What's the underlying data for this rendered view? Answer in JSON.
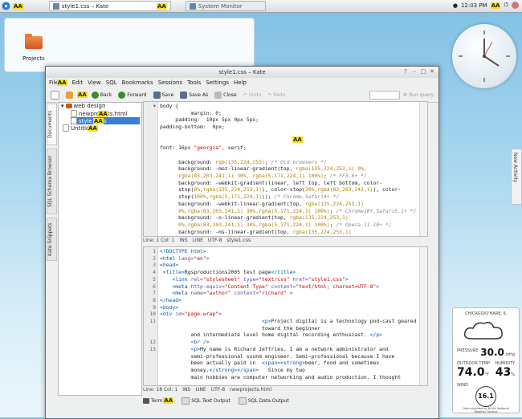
{
  "panel": {
    "task_active": "style1.css – Kate",
    "task_inactive": "System Monitor",
    "time": "12:03 PM",
    "aa": "AA"
  },
  "desktop": {
    "folder_label": "Projects"
  },
  "activity_tab": "New Activity",
  "weather": {
    "station": "CHICAGO/O'HARE, IL",
    "pressure_label": "PRESSURE",
    "pressure_value": "30.0",
    "pressure_unit": "inHg",
    "outdoor_label": "OUTDOOR TEMP",
    "outdoor_value": "74.0",
    "outdoor_unit": "°F",
    "humidity_label": "HUMIDITY",
    "humidity_value": "43",
    "humidity_unit": "%",
    "wind_label": "WIND",
    "wind_value": "16.1",
    "footer": "Data provided by NOAA National Weather Service"
  },
  "kate": {
    "title": "style1.css – Kate",
    "menu": [
      "File",
      "Edit",
      "View",
      "SQL",
      "Bookmarks",
      "Sessions",
      "Tools",
      "Settings",
      "Help"
    ],
    "toolbar": {
      "back": "Back",
      "forward": "Forward",
      "save": "Save",
      "save_as": "Save As",
      "close": "Close",
      "undo": "Undo",
      "redo": "Redo",
      "run_query": "Run query"
    },
    "sidetabs": [
      "Documents",
      "SQL Schema Browser",
      "Kate Snippets"
    ],
    "tree": {
      "folder": "web design",
      "file1": "newprojects.html",
      "file2": "style1.css",
      "untitled": "Untitled"
    },
    "pane1_lines": [
      {
        "html": "body {"
      },
      {
        "html": "          margin: 0;"
      },
      {
        "html": "     padding:  10px 5px 0px 5px;"
      },
      {
        "html": "padding-bottom:  0px;"
      },
      {
        "html": ""
      },
      {
        "html": ""
      },
      {
        "html": "font: 16px <span class=\"c-str\">\"georgia\"</span>, serif;"
      },
      {
        "html": ""
      },
      {
        "html": "      background: <span class=\"c-num\">rgb(135,224,253)</span>; <span class=\"c-com\">/* Old browsers */</span>"
      },
      {
        "html": "      background: -moz-linear-gradient(top, <span class=\"c-num\">rgba(135,224,253,1) 0%,</span>"
      },
      {
        "html": "      <span class=\"c-num\">rgba(83,203,241,1) 30%, rgba(5,171,224,1) 100%)</span>; <span class=\"c-com\">/* FF3.6+ */</span>"
      },
      {
        "html": "      background: -webkit-gradient(linear, left top, left bottom, color-"
      },
      {
        "html": "      stop(<span class=\"c-num\">0%,rgba(135,224,253,1)</span>), color-stop(<span class=\"c-num\">30%,rgba(83,203,241,1)</span>), color-"
      },
      {
        "html": "      stop(<span class=\"c-num\">100%,rgba(5,171,224,1)</span>)); <span class=\"c-com\">/* Chrome,Safari4+ */</span>"
      },
      {
        "html": "      background: -webkit-linear-gradient(top, <span class=\"c-num\">rgba(135,224,253,1)</span>"
      },
      {
        "html": "      <span class=\"c-num\">0%,rgba(83,203,241,1) 30%,rgba(5,171,224,1) 100%)</span>; <span class=\"c-com\">/* Chrome10+,Safari5.1+ */</span>"
      },
      {
        "html": "      background: -o-linear-gradient(top, <span class=\"c-num\">rgba(135,224,253,1)</span>"
      },
      {
        "html": "      <span class=\"c-num\">0%,rgba(83,203,241,1) 30%,rgba(5,171,224,1) 100%)</span>; <span class=\"c-com\">/* Opera 11.10+ */</span>"
      },
      {
        "html": "      background: -ms-linear-gradient(top, <span class=\"c-num\">rgba(135,224,253,1)</span>"
      }
    ],
    "status1": [
      "Line: 1 Col: 1",
      "INS",
      "LINE",
      "UTF-8",
      "style1.css"
    ],
    "pane2_lines": [
      {
        "n": "1",
        "html": "<span class=\"c-tag\">&lt;!DOCTYPE html&gt;</span>"
      },
      {
        "n": "2",
        "html": "<span class=\"c-tag\">&lt;html</span> <span class=\"c-attr\">lang=</span><span class=\"c-str\">\"en\"</span><span class=\"c-tag\">&gt;</span>"
      },
      {
        "n": "3",
        "html": "<span class=\"c-tag\">&lt;head&gt;</span>"
      },
      {
        "n": "4",
        "html": " <span class=\"c-tag\">&lt;title&gt;</span>Rgsproductions2005 test page<span class=\"c-tag\">&lt;/title&gt;</span>"
      },
      {
        "n": "5",
        "html": "    <span class=\"c-tag\">&lt;link</span> <span class=\"c-attr\">rel=</span><span class=\"c-str\">\"stylesheet\"</span> <span class=\"c-attr\">type=</span><span class=\"c-str\">\"text/css\"</span> <span class=\"c-attr\">href=</span><span class=\"c-str\">\"style1.css\"</span><span class=\"c-tag\">&gt;</span>"
      },
      {
        "n": "6",
        "html": "    <span class=\"c-tag\">&lt;meta</span> <span class=\"c-attr\">http-equiv=</span><span class=\"c-str\">\"Content-Type\"</span> <span class=\"c-attr\">content=</span><span class=\"c-str\">\"text/html; charset=UTF-8\"</span><span class=\"c-tag\">&gt;</span>"
      },
      {
        "n": "7",
        "html": "    <span class=\"c-tag\">&lt;meta</span> <span class=\"c-attr\">name=</span><span class=\"c-str\">\"author\"</span> <span class=\"c-attr\">content=</span><span class=\"c-str\">\"richard\"</span> <span class=\"c-tag\">&gt;</span>"
      },
      {
        "n": "8",
        "html": "<span class=\"c-tag\">&lt;/head&gt;</span>"
      },
      {
        "n": "9",
        "html": "<span class=\"c-tag\">&lt;body&gt;</span>"
      },
      {
        "n": "10",
        "html": "<span class=\"c-tag\">&lt;div</span> <span class=\"c-attr\">id=</span><span class=\"c-str\">\"page-wrap\"</span><span class=\"c-tag\">&gt;</span>"
      },
      {
        "n": "11",
        "html": "                                 <span class=\"c-tag\">&lt;p&gt;</span>Project digital is a technology pod-cast geared"
      },
      {
        "n": "",
        "html": "                                 toward the beginner"
      },
      {
        "n": "",
        "html": "          and intermediate level home digital recording enthusiast. <span class=\"c-tag\">&lt;/p&gt;</span>"
      },
      {
        "n": "12",
        "html": "          <span class=\"c-tag\">&lt;br /&gt;</span>"
      },
      {
        "n": "13",
        "html": "          <span class=\"c-tag\">&lt;p&gt;</span>My name is Richard Jeffries. I am a network administrator and"
      },
      {
        "n": "",
        "html": "          semi-professional sound engineer. Semi-professional because I have"
      },
      {
        "n": "",
        "html": "          been actually paid in  <span class=\"c-tag\">&lt;span&gt;&lt;strong&gt;</span>beer, food and sometimes"
      },
      {
        "n": "",
        "html": "          money.<span class=\"c-tag\">&lt;/strong&gt;&lt;/span&gt;</span>   Since my two"
      },
      {
        "n": "",
        "html": "          main hobbies are computer networking and audio production. I thought"
      }
    ],
    "status2": [
      "Line: 18 Col: 1",
      "INS",
      "LINE",
      "UTF-8",
      "newprojects.html"
    ],
    "bottom_tabs": [
      "Terminal",
      "SQL Text Output",
      "SQL Data Output"
    ]
  }
}
